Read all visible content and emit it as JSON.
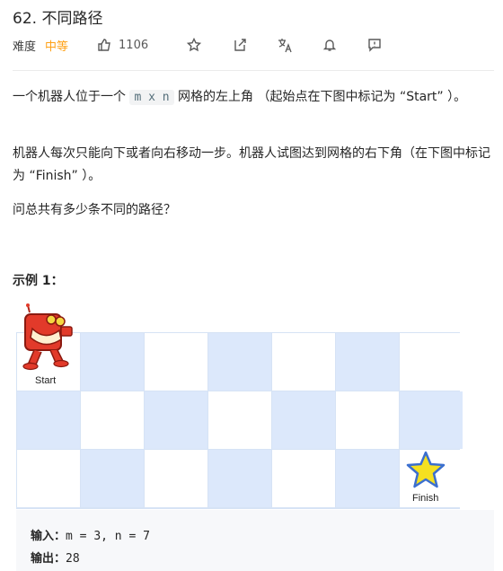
{
  "problem": {
    "title": "62. 不同路径",
    "difficulty_label": "难度",
    "difficulty": "中等",
    "likes": "1106"
  },
  "toolbar": {
    "icons": [
      "thumbs-up-icon",
      "star-icon",
      "share-icon",
      "translate-icon",
      "bell-icon",
      "feedback-icon"
    ]
  },
  "description": {
    "p1_a": "一个机器人位于一个 ",
    "p1_code": "m x n",
    "p1_b": " 网格的左上角 （起始点在下图中标记为 “Start” ）。",
    "p2": "机器人每次只能向下或者向右移动一步。机器人试图达到网格的右下角（在下图中标记为 “Finish” ）。",
    "p3": "问总共有多少条不同的路径？"
  },
  "example": {
    "title": "示例 1：",
    "start_label": "Start",
    "finish_label": "Finish",
    "input_label": "输入：",
    "input_value": "m = 3, n = 7",
    "output_label": "输出：",
    "output_value": "28"
  },
  "colors": {
    "accent_difficulty": "#ffa116",
    "grid_blue": "#dce8fb",
    "robot_red": "#e23a2a",
    "star_yellow": "#f5e020"
  }
}
